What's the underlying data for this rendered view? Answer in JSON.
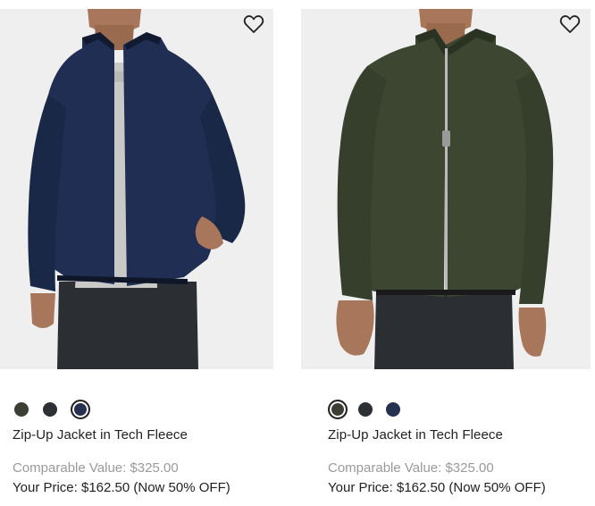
{
  "products": [
    {
      "title": "Zip-Up Jacket in Tech Fleece",
      "comparable_value": "Comparable Value: $325.00",
      "your_price": "Your Price: $162.50 (Now 50% OFF)",
      "wishlist_icon": "heart-outline-icon",
      "jacket_color": "#1f2e52",
      "swatches": [
        {
          "color": "#3b3f33",
          "selected": false
        },
        {
          "color": "#2c2f33",
          "selected": false
        },
        {
          "color": "#26304f",
          "selected": true
        }
      ]
    },
    {
      "title": "Zip-Up Jacket in Tech Fleece",
      "comparable_value": "Comparable Value: $325.00",
      "your_price": "Your Price: $162.50 (Now 50% OFF)",
      "wishlist_icon": "heart-outline-icon",
      "jacket_color": "#3c4631",
      "swatches": [
        {
          "color": "#3b3f33",
          "selected": true
        },
        {
          "color": "#2c2f33",
          "selected": false
        },
        {
          "color": "#26304f",
          "selected": false
        }
      ]
    }
  ]
}
